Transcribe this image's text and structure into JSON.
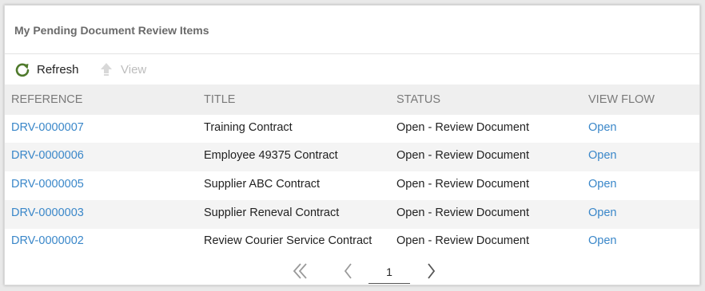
{
  "panel": {
    "title": "My Pending Document Review Items"
  },
  "toolbar": {
    "refresh_label": "Refresh",
    "view_label": "View",
    "refresh_icon": "refresh-icon",
    "view_icon": "arrow-up-icon"
  },
  "table": {
    "headers": {
      "reference": "REFERENCE",
      "title": "TITLE",
      "status": "STATUS",
      "view_flow": "VIEW FLOW"
    },
    "rows": [
      {
        "reference": "DRV-0000007",
        "title": "Training Contract",
        "status": "Open - Review Document",
        "view_flow": "Open"
      },
      {
        "reference": "DRV-0000006",
        "title": "Employee 49375 Contract",
        "status": "Open - Review Document",
        "view_flow": "Open"
      },
      {
        "reference": "DRV-0000005",
        "title": "Supplier ABC Contract",
        "status": "Open - Review Document",
        "view_flow": "Open"
      },
      {
        "reference": "DRV-0000003",
        "title": "Supplier Reneval Contract",
        "status": "Open - Review Document",
        "view_flow": "Open"
      },
      {
        "reference": "DRV-0000002",
        "title": "Review Courier Service Contract",
        "status": "Open - Review Document",
        "view_flow": "Open"
      }
    ]
  },
  "pager": {
    "current_page": "1"
  },
  "colors": {
    "link": "#3a87c9",
    "header_bg": "#efefef",
    "alt_row_bg": "#f4f4f4",
    "refresh_icon": "#4f7a2c"
  }
}
